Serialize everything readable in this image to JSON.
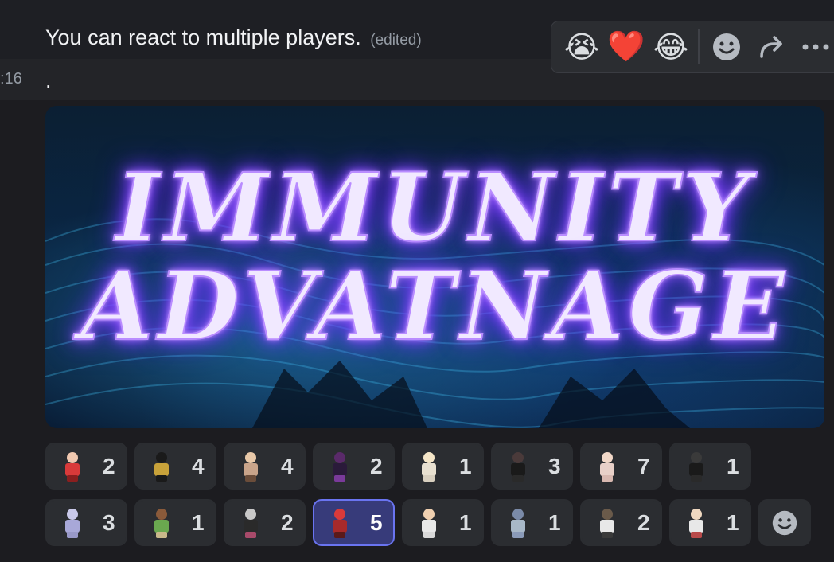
{
  "message": {
    "text": "You can react to multiple players.",
    "edited_label": "(edited)",
    "timestamp": ":16",
    "second_line": "."
  },
  "toolbar": {
    "quick_reactions": [
      "😭",
      "❤️",
      "😂"
    ],
    "add_reaction_icon": "smile-icon",
    "forward_icon": "forward-arrow-icon",
    "more_icon": "more-dots-icon"
  },
  "banner": {
    "line1": "IMMUNITY",
    "line2": "ADVATNAGE"
  },
  "reactions": {
    "row1": [
      {
        "count": "2",
        "colors": [
          "#f0c8b0",
          "#d93a3a",
          "#8a1f1f"
        ]
      },
      {
        "count": "4",
        "colors": [
          "#1a1a1a",
          "#c8a23a",
          "#1a1a1a"
        ]
      },
      {
        "count": "4",
        "colors": [
          "#e8c8a8",
          "#c9a48a",
          "#6b4d3a"
        ]
      },
      {
        "count": "2",
        "colors": [
          "#5a2a6a",
          "#2a1a3a",
          "#7a3a9a"
        ]
      },
      {
        "count": "1",
        "colors": [
          "#f5e6c8",
          "#e8e0d0",
          "#d8cfbf"
        ]
      },
      {
        "count": "3",
        "colors": [
          "#4a3a3a",
          "#1a1a1a",
          "#2a2a2a"
        ]
      },
      {
        "count": "7",
        "colors": [
          "#f2d8c8",
          "#e8d0c8",
          "#d8b8b0"
        ]
      },
      {
        "count": "1",
        "colors": [
          "#3a3a3a",
          "#1a1a1a",
          "#2a2a2a"
        ]
      }
    ],
    "row2": [
      {
        "count": "3",
        "colors": [
          "#c8c8e8",
          "#a8a8d8",
          "#9898c8"
        ],
        "active": false
      },
      {
        "count": "1",
        "colors": [
          "#8a5a3a",
          "#6aa84f",
          "#c8b88a"
        ],
        "active": false
      },
      {
        "count": "2",
        "colors": [
          "#c8c8c8",
          "#2a2a2a",
          "#a84a6a"
        ],
        "active": false
      },
      {
        "count": "5",
        "colors": [
          "#d93a3a",
          "#a82a2a",
          "#5a1a1a"
        ],
        "active": true
      },
      {
        "count": "1",
        "colors": [
          "#f0d0b0",
          "#e8e8e8",
          "#d8d8d8"
        ],
        "active": false
      },
      {
        "count": "1",
        "colors": [
          "#7a8aa8",
          "#a8b8c8",
          "#8a9ab8"
        ],
        "active": false
      },
      {
        "count": "2",
        "colors": [
          "#6a5a4a",
          "#e8e8e8",
          "#3a3a3a"
        ],
        "active": false
      },
      {
        "count": "1",
        "colors": [
          "#f0d8c0",
          "#e8e8e8",
          "#b84a4a"
        ],
        "active": false
      }
    ],
    "add_icon": "smile-icon"
  }
}
